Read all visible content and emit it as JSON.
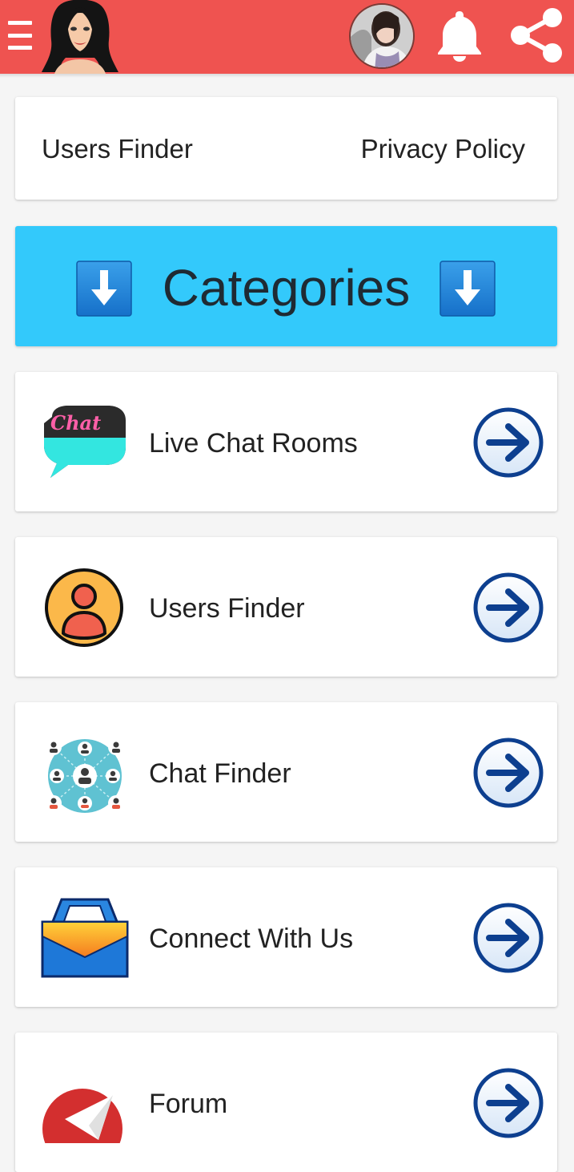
{
  "app": {
    "colors": {
      "topbar": "#ef5350",
      "banner": "#33c9fb",
      "arrow": "#0d3f8f"
    }
  },
  "topbar": {
    "icons": [
      "menu-icon",
      "app-logo",
      "user-avatar",
      "bell-icon",
      "share-icon"
    ]
  },
  "links": {
    "left": "Users Finder",
    "right": "Privacy Policy"
  },
  "banner": {
    "title": "Categories",
    "icon": "download-arrow-icon"
  },
  "items": [
    {
      "label": "Live Chat Rooms",
      "icon": "chat-bubble-icon"
    },
    {
      "label": "Users Finder",
      "icon": "user-icon"
    },
    {
      "label": "Chat Finder",
      "icon": "network-icon"
    },
    {
      "label": "Connect With Us",
      "icon": "mailbox-icon"
    },
    {
      "label": "Forum",
      "icon": "forum-icon"
    }
  ]
}
